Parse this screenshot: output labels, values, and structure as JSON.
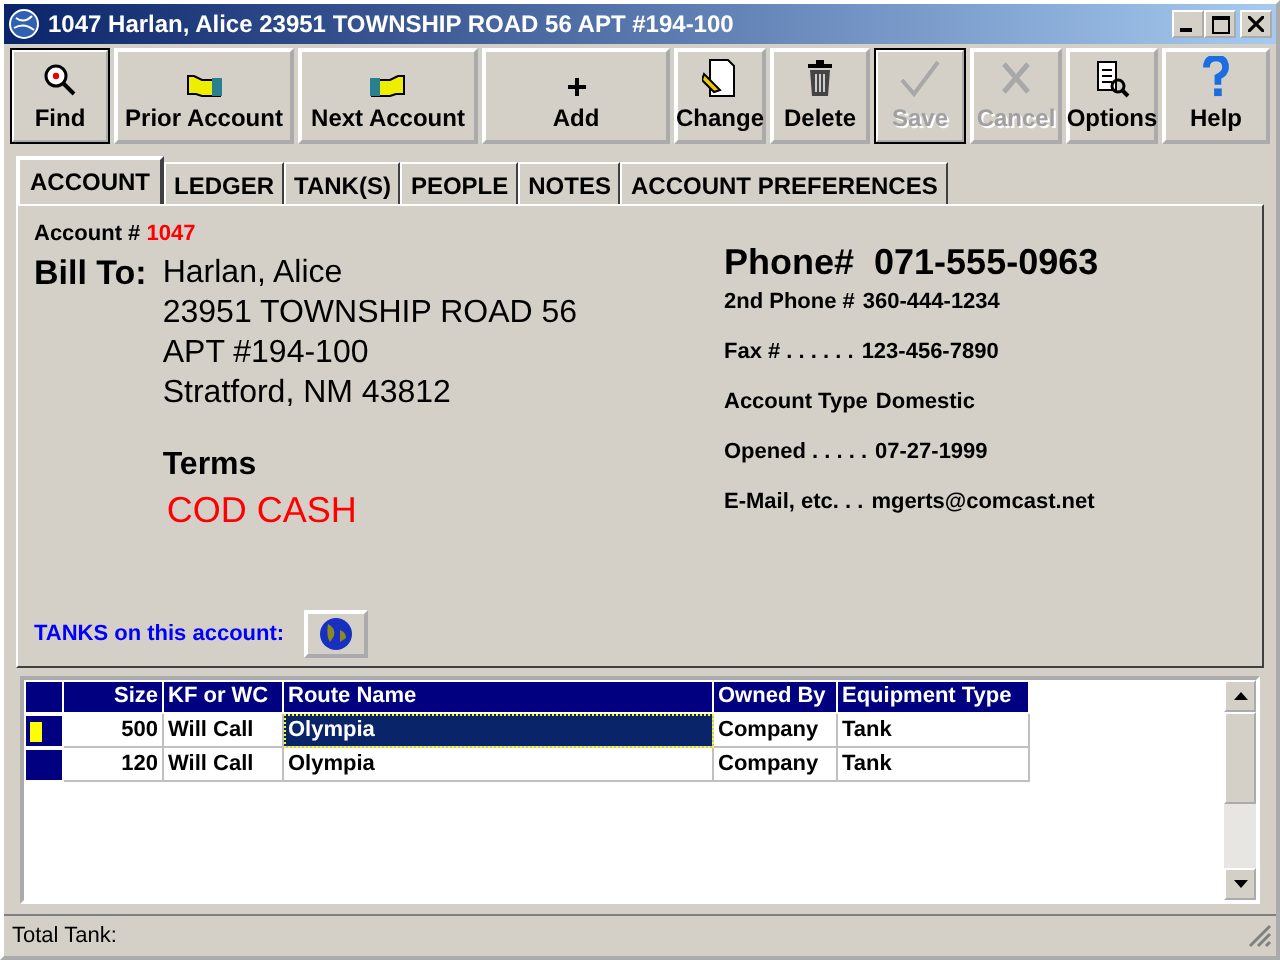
{
  "window": {
    "title": "1047 Harlan, Alice 23951 TOWNSHIP ROAD 56 APT #194-100"
  },
  "toolbar": [
    {
      "label": "Find",
      "disabled": false
    },
    {
      "label": "Prior Account",
      "disabled": false
    },
    {
      "label": "Next Account",
      "disabled": false
    },
    {
      "label": "Add",
      "disabled": false
    },
    {
      "label": "Change",
      "disabled": false
    },
    {
      "label": "Delete",
      "disabled": false
    },
    {
      "label": "Save",
      "disabled": true
    },
    {
      "label": "Cancel",
      "disabled": true
    },
    {
      "label": "Options",
      "disabled": false
    },
    {
      "label": "Help",
      "disabled": false
    }
  ],
  "tabs": [
    {
      "label": "ACCOUNT",
      "selected": true
    },
    {
      "label": "LEDGER",
      "selected": false
    },
    {
      "label": "TANK(S)",
      "selected": false
    },
    {
      "label": "PEOPLE",
      "selected": false
    },
    {
      "label": "NOTES",
      "selected": false
    },
    {
      "label": "ACCOUNT PREFERENCES",
      "selected": false
    }
  ],
  "account": {
    "label": "Account #",
    "number": "1047"
  },
  "bill_to": {
    "label": "Bill To:",
    "lines": [
      "Harlan, Alice",
      "23951 TOWNSHIP ROAD 56",
      "APT #194-100",
      "Stratford, NM 43812"
    ]
  },
  "terms": {
    "label": "Terms",
    "value": "COD CASH"
  },
  "phone": {
    "label": "Phone#",
    "value": "071-555-0963"
  },
  "details": [
    {
      "label": "2nd Phone #",
      "value": "360-444-1234"
    },
    {
      "label": "Fax # . . . . . .",
      "value": "123-456-7890"
    },
    {
      "label": "Account Type",
      "value": "Domestic"
    },
    {
      "label": "Opened . . . . .",
      "value": "07-27-1999"
    },
    {
      "label": "E-Mail, etc. . .",
      "value": "mgerts@comcast.net"
    }
  ],
  "tanks_label": "TANKS on this account:",
  "table": {
    "columns": [
      "Size",
      "KF or WC",
      "Route Name",
      "Owned By",
      "Equipment Type"
    ],
    "rows": [
      {
        "cells": [
          "500",
          "Will Call",
          "Olympia",
          "Company",
          "Tank"
        ],
        "selected": true
      },
      {
        "cells": [
          "120",
          "Will Call",
          "Olympia",
          "Company",
          "Tank"
        ],
        "selected": false
      }
    ]
  },
  "status_bar": "Total Tank:"
}
